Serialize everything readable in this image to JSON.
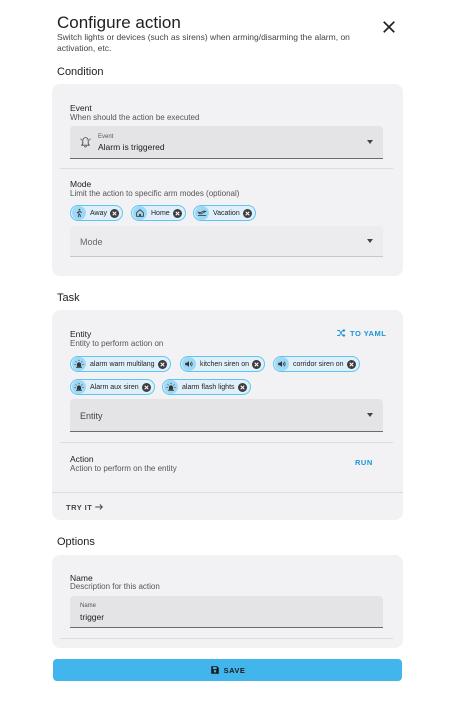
{
  "dialog": {
    "title": "Configure action",
    "subtitle": "Switch lights or devices (such as sirens) when arming/disarming the alarm, on activation, etc."
  },
  "condition": {
    "section_title": "Condition",
    "event": {
      "label": "Event",
      "description": "When should the action be executed",
      "floating_label": "Event",
      "value": "Alarm is triggered"
    },
    "mode": {
      "label": "Mode",
      "description": "Limit the action to specific arm modes (optional)",
      "chips": [
        {
          "label": "Away",
          "icon": "walk-icon"
        },
        {
          "label": "Home",
          "icon": "home-icon"
        },
        {
          "label": "Vacation",
          "icon": "airplane-icon"
        }
      ],
      "placeholder": "Mode"
    }
  },
  "task": {
    "section_title": "Task",
    "entity": {
      "label": "Entity",
      "description": "Entity to perform action on",
      "yaml_button": "TO YAML",
      "chips": [
        {
          "label": "alarm warn multilang",
          "icon": "alarm-light-icon"
        },
        {
          "label": "kitchen siren on",
          "icon": "volume-icon"
        },
        {
          "label": "corridor siren on",
          "icon": "volume-icon"
        },
        {
          "label": "Alarm aux siren",
          "icon": "alarm-light-icon"
        },
        {
          "label": "alarm flash lights",
          "icon": "alarm-light-icon"
        }
      ],
      "placeholder": "Entity"
    },
    "action": {
      "label": "Action",
      "description": "Action to perform on the entity",
      "run_button": "RUN"
    },
    "try_it": "TRY IT"
  },
  "options": {
    "section_title": "Options",
    "name": {
      "label": "Name",
      "description": "Description for this action",
      "floating_label": "Name",
      "value": "trigger"
    }
  },
  "save_button": "SAVE",
  "colors": {
    "accent": "#41b5ec",
    "link": "#1d93d6",
    "chip_bg": "#e0f0fb",
    "chip_border": "#5dc5f5",
    "card_bg": "#f2f2f4"
  }
}
